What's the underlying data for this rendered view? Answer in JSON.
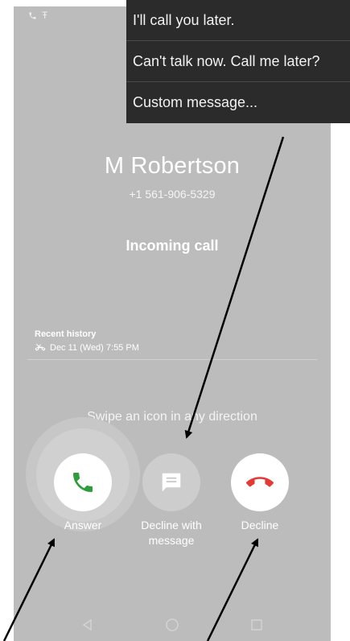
{
  "status_bar": {
    "call_icon": "phone-call-icon",
    "carrier_icon": "t-mobile-icon",
    "carrier_glyph": "Ŧ"
  },
  "quick_replies": [
    {
      "label": "I'll call you later."
    },
    {
      "label": "Can't talk now. Call me later?"
    },
    {
      "label": "Custom message..."
    }
  ],
  "caller": {
    "name": "M Robertson",
    "number": "+1 561-906-5329"
  },
  "call_status": "Incoming call",
  "recent_history": {
    "title": "Recent history",
    "entry": "Dec 11 (Wed) 7:55 PM",
    "entry_icon": "missed-call-icon"
  },
  "swipe_hint": "Swipe an icon in any direction",
  "actions": {
    "answer": {
      "label": "Answer",
      "icon": "phone-icon",
      "color": "#2e9e3c"
    },
    "decline_with_message": {
      "label_line1": "Decline with",
      "label_line2": "message",
      "icon": "message-icon"
    },
    "decline": {
      "label": "Decline",
      "icon": "hang-up-icon",
      "color": "#e53935"
    }
  },
  "nav": {
    "back_icon": "back-icon",
    "home_icon": "home-icon",
    "recents_icon": "recents-icon"
  },
  "colors": {
    "background": "#bcbcbc",
    "popup": "#2b2b2b",
    "answer": "#2e9e3c",
    "decline": "#e53935"
  }
}
